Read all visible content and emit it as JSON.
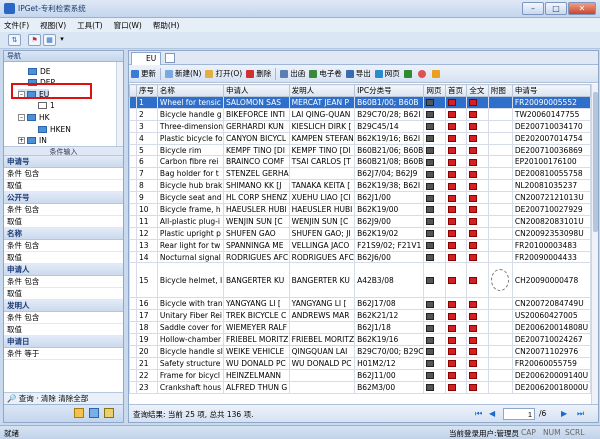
{
  "window": {
    "title": "IPGet-专利检索系统",
    "minimize": "–",
    "maximize": "□",
    "close": "✕"
  },
  "menu": [
    "文件(F)",
    "视图(V)",
    "工具(T)",
    "窗口(W)",
    "帮助(H)"
  ],
  "nav": {
    "title": "导航",
    "tree": [
      {
        "label": "DE",
        "expanded": false
      },
      {
        "label": "DEP",
        "expanded": false
      },
      {
        "label": "EU",
        "expanded": true,
        "selected": true
      },
      {
        "label": "1",
        "child": true
      },
      {
        "label": "HK",
        "expanded": true
      },
      {
        "label": "HKEN",
        "child": true
      },
      {
        "label": "IN",
        "expanded": false
      }
    ]
  },
  "conditions": {
    "title": "条件输入",
    "sections": [
      {
        "name": "申请号",
        "rows": [
          "条件 包含",
          "取值"
        ]
      },
      {
        "name": "公开号",
        "rows": [
          "条件 包含",
          "取值"
        ]
      },
      {
        "name": "名称",
        "rows": [
          "条件 包含",
          "取值"
        ]
      },
      {
        "name": "申请人",
        "rows": [
          "条件 包含",
          "取值"
        ]
      },
      {
        "name": "发明人",
        "rows": [
          "条件 包含",
          "取值"
        ]
      },
      {
        "name": "申请日",
        "rows": [
          "条件 等于"
        ]
      }
    ],
    "footer": "🔎 查询 · 清除 清除全部"
  },
  "tab": {
    "label": "EU"
  },
  "toolbar": [
    {
      "label": "更新",
      "color": "#3a7bd5"
    },
    {
      "label": "新建(N)",
      "color": "#7aa8e0"
    },
    {
      "label": "打开(O)",
      "color": "#e0b040"
    },
    {
      "label": "删除",
      "color": "#d03030"
    },
    {
      "label": "出函",
      "color": "#5a7fb0"
    },
    {
      "label": "电子卷",
      "color": "#3a8a3a"
    },
    {
      "label": "导出",
      "color": "#3a6ab0"
    },
    {
      "label": "网页",
      "color": "#2a8ad0"
    }
  ],
  "table": {
    "headers": [
      "序号",
      "名称",
      "申请人",
      "发明人",
      "IPC分类号",
      "网页",
      "首页",
      "全文",
      "附图",
      "申请号"
    ],
    "rows": [
      {
        "n": "1",
        "name": "Wheel for tensic",
        "app": "SALOMON SAS",
        "inv": "MERCAT JEAN P",
        "ipc": "B60B1/00; B60B",
        "no": "FR20090005552",
        "sel": true
      },
      {
        "n": "2",
        "name": "Bicycle handle g",
        "app": "BIKEFORCE INTI",
        "inv": "LAI QING-QUAN",
        "ipc": "B29C70/28; B62I",
        "no": "TW20060147755"
      },
      {
        "n": "3",
        "name": "Three-dimension",
        "app": "GERHARDI KUN",
        "inv": "KIESLICH DIRK [",
        "ipc": "B29C45/14",
        "no": "DE200710034170"
      },
      {
        "n": "4",
        "name": "Plastic bicycle fo",
        "app": "CANYON BICYCL",
        "inv": "KAMPEN STEFAN",
        "ipc": "B62K19/16; B62I",
        "no": "DE202007014754"
      },
      {
        "n": "5",
        "name": "Bicycle rim",
        "app": "KEMPF TINO [DI",
        "inv": "KEMPF TINO [DI",
        "ipc": "B60B21/06; B60B",
        "no": "DE200710036869"
      },
      {
        "n": "6",
        "name": "Carbon fibre rei",
        "app": "BRAINCO COMF",
        "inv": "TSAI CARLOS [T",
        "ipc": "B60B21/08; B60B",
        "no": "EP20100176100"
      },
      {
        "n": "7",
        "name": "Bag holder for t",
        "app": "STENZEL GERHA",
        "inv": "",
        "ipc": "B62J7/04; B62J9",
        "no": "DE200810055758"
      },
      {
        "n": "8",
        "name": "Bicycle hub brak",
        "app": "SHIMANO KK [J",
        "inv": "TANAKA KEITA [",
        "ipc": "B62K19/38; B62I",
        "no": "NL20081035237"
      },
      {
        "n": "9",
        "name": "Bicycle seat and",
        "app": "HL CORP SHENZ",
        "inv": "XUEHU LIAO [CI",
        "ipc": "B62J1/00",
        "no": "CN20072121013U"
      },
      {
        "n": "10",
        "name": "Bicycle frame, h",
        "app": "HAEUSLER HUBI",
        "inv": "HAEUSLER HUBI",
        "ipc": "B62K19/00",
        "no": "DE200710027929"
      },
      {
        "n": "11",
        "name": "All-plastic plug-i",
        "app": "WENJIN SUN [C",
        "inv": "WENJIN SUN [C",
        "ipc": "B62J9/00",
        "no": "CN20082083101U"
      },
      {
        "n": "12",
        "name": "Plastic upright p",
        "app": "SHUFEN GAO",
        "inv": "SHUFEN GAO; JI",
        "ipc": "B62K19/02",
        "no": "CN20092353098U"
      },
      {
        "n": "13",
        "name": "Rear light for tw",
        "app": "SPANNINGA ME",
        "inv": "VELLINGA JACO",
        "ipc": "F21S9/02; F21V1",
        "no": "FR20100003483"
      },
      {
        "n": "14",
        "name": "Nocturnal signal",
        "app": "RODRIGUES AFC",
        "inv": "RODRIGUES AFC",
        "ipc": "B62J6/00",
        "no": "FR20090004433"
      },
      {
        "n": "15",
        "name": "Bicycle helmet, I",
        "app": "BANGERTER KU",
        "inv": "BANGERTER KU",
        "ipc": "A42B3/08",
        "no": "CH20090000478",
        "tall": true
      },
      {
        "n": "16",
        "name": "Bicycle with tran",
        "app": "YANGYANG LI [",
        "inv": "YANGYANG LI [",
        "ipc": "B62J17/08",
        "no": "CN20072084749U"
      },
      {
        "n": "17",
        "name": "Unitary Fiber Rei",
        "app": "TREK BICYCLE C",
        "inv": "ANDREWS MAR",
        "ipc": "B62K21/12",
        "no": "US20060427005"
      },
      {
        "n": "18",
        "name": "Saddle cover for",
        "app": "WIEMEYER RALF",
        "inv": "",
        "ipc": "B62J1/18",
        "no": "DE200620014808U"
      },
      {
        "n": "19",
        "name": "Hollow-chamber",
        "app": "FRIEBEL MORITZ",
        "inv": "FRIEBEL MORITZ",
        "ipc": "B62K19/16",
        "no": "DE200710024267"
      },
      {
        "n": "20",
        "name": "Bicycle handle sl",
        "app": "WEIKE VEHICLE",
        "inv": "QINGQUAN LAI",
        "ipc": "B29C70/00; B29C",
        "no": "CN20071102976"
      },
      {
        "n": "21",
        "name": "Safety structure",
        "app": "WU DONALD PC",
        "inv": "WU DONALD PC",
        "ipc": "H01M2/12",
        "no": "FR20060055759"
      },
      {
        "n": "22",
        "name": "Frame for bicycl",
        "app": "HEINZELMANN",
        "inv": "",
        "ipc": "B62J11/00",
        "no": "DE200620009140U"
      },
      {
        "n": "23",
        "name": "Crankshaft hous",
        "app": "ALFRED THUN G",
        "inv": "",
        "ipc": "B62M3/00",
        "no": "DE200620018000U"
      }
    ]
  },
  "result": "查询结果: 当前 25 项, 总共 136 项.",
  "pager": {
    "current": "1",
    "total": "/6"
  },
  "status": {
    "left": "就绪",
    "right": "当前登录用户:管理员",
    "caps": "CAP",
    "num": "NUM",
    "scrl": "SCRL"
  }
}
